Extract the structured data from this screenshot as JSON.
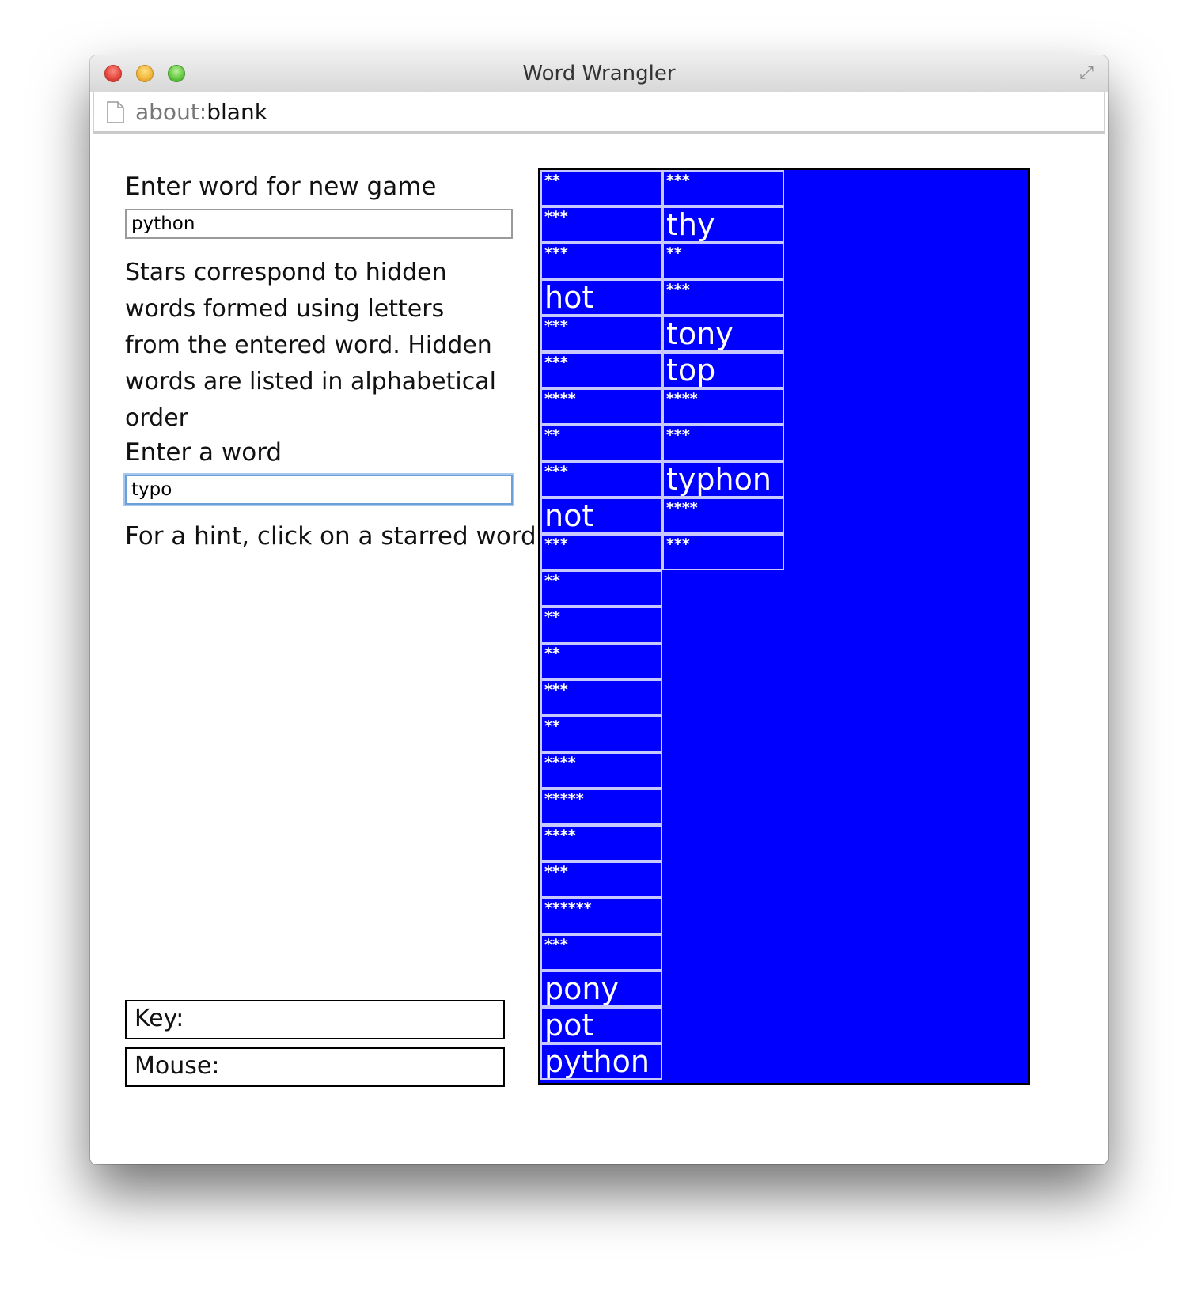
{
  "window": {
    "title": "Word Wrangler",
    "url_scheme": "about:",
    "url_path": "blank"
  },
  "form": {
    "new_game_label": "Enter word for new game",
    "new_game_value": "python",
    "instructions": "Stars correspond to hidden words formed using letters from the entered word. Hidden words are listed in alphabetical order",
    "enter_word_label": "Enter a word",
    "enter_word_value": "typo",
    "hint_text": "For a hint, click on a starred word"
  },
  "status": {
    "key_label": "Key:",
    "mouse_label": "Mouse:"
  },
  "colors": {
    "canvas_bg": "#0000ff",
    "cell_border": "#c8c8ff",
    "text": "#ffffff"
  },
  "grid": {
    "columns": [
      [
        "**",
        "***",
        "***",
        "hot",
        "***",
        "***",
        "****",
        "**",
        "***",
        "not",
        "***",
        "**",
        "**",
        "**",
        "***",
        "**",
        "****",
        "*****",
        "****",
        "***",
        "******",
        "***",
        "pony",
        "pot",
        "python"
      ],
      [
        "***",
        "thy",
        "**",
        "***",
        "tony",
        "top",
        "****",
        "***",
        "typhon",
        "****",
        "***"
      ]
    ]
  }
}
